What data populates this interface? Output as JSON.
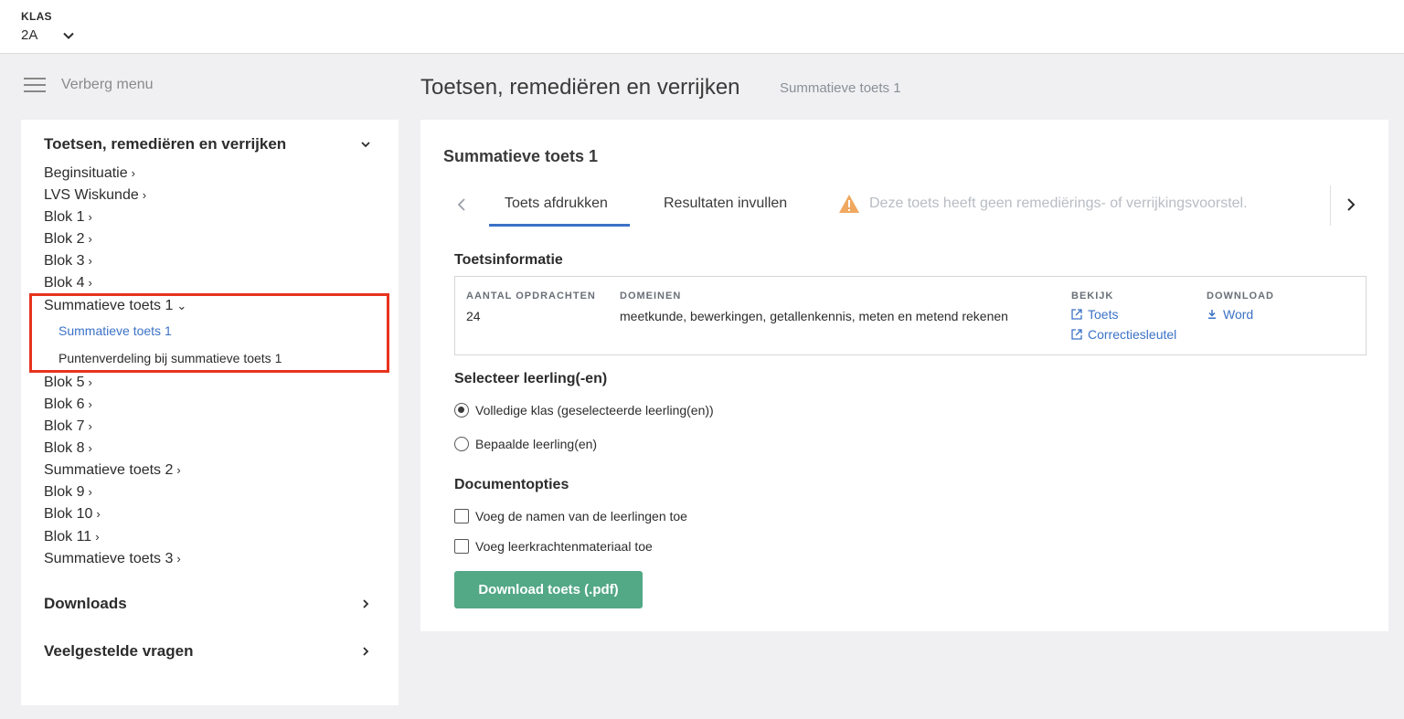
{
  "topbar": {
    "klas_label": "KLAS",
    "klas_value": "2A"
  },
  "menu_toggle": {
    "label": "Verberg menu"
  },
  "header": {
    "title": "Toetsen, remediëren en verrijken",
    "subtitle": "Summatieve toets 1"
  },
  "sidebar": {
    "section_title": "Toetsen, remediëren en verrijken",
    "items": [
      {
        "label": "Beginsituatie",
        "caret": "›"
      },
      {
        "label": "LVS Wiskunde",
        "caret": "›"
      },
      {
        "label": "Blok 1",
        "caret": "›"
      },
      {
        "label": "Blok 2",
        "caret": "›"
      },
      {
        "label": "Blok 3",
        "caret": "›"
      },
      {
        "label": "Blok 4",
        "caret": "›"
      },
      {
        "label": "Summatieve toets 1",
        "caret": "⌄"
      },
      {
        "label": "Blok 5",
        "caret": "›"
      },
      {
        "label": "Blok 6",
        "caret": "›"
      },
      {
        "label": "Blok 7",
        "caret": "›"
      },
      {
        "label": "Blok 8",
        "caret": "›"
      },
      {
        "label": "Summatieve toets 2",
        "caret": "›"
      },
      {
        "label": "Blok 9",
        "caret": "›"
      },
      {
        "label": "Blok 10",
        "caret": "›"
      },
      {
        "label": "Blok 11",
        "caret": "›"
      },
      {
        "label": "Summatieve toets 3",
        "caret": "›"
      }
    ],
    "subitems": [
      {
        "label": "Summatieve toets 1"
      },
      {
        "label": "Puntenverdeling bij summatieve toets 1"
      }
    ],
    "downloads": "Downloads",
    "faq": "Veelgestelde vragen"
  },
  "card": {
    "title": "Summatieve toets 1",
    "tabs": [
      {
        "label": "Toets afdrukken"
      },
      {
        "label": "Resultaten invullen"
      }
    ],
    "warning": "Deze toets heeft geen remediërings- of verrijkingsvoorstel.",
    "info_title": "Toetsinformatie",
    "info": {
      "count_head": "AANTAL OPDRACHTEN",
      "count_value": "24",
      "domains_head": "DOMEINEN",
      "domains_value": "meetkunde, bewerkingen, getallenkennis, meten en metend rekenen",
      "view_head": "BEKIJK",
      "view_links": [
        "Toets",
        "Correctiesleutel"
      ],
      "download_head": "DOWNLOAD",
      "download_link": "Word"
    },
    "select_title": "Selecteer leerling(-en)",
    "radios": [
      {
        "label": "Volledige klas (geselecteerde leerling(en))",
        "checked": true
      },
      {
        "label": "Bepaalde leerling(en)",
        "checked": false
      }
    ],
    "doc_title": "Documentopties",
    "checkboxes": [
      {
        "label": "Voeg de namen van de leerlingen toe",
        "checked": false
      },
      {
        "label": "Voeg leerkrachtenmateriaal toe",
        "checked": false
      }
    ],
    "download_button": "Download toets (.pdf)"
  },
  "colors": {
    "accent": "#3b72c6",
    "button": "#53a886",
    "highlight": "#e8321e",
    "warning": "#f0a860"
  }
}
